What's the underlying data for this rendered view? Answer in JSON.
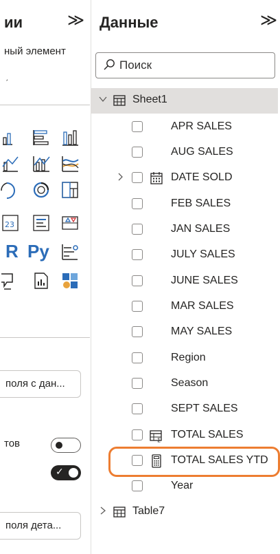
{
  "left_panel": {
    "title_fragment": "ии",
    "collapse_glyph": "≫",
    "subtitle_fragment": "ный элемент",
    "small_mark": "ˏ",
    "text_tiles": [
      "R",
      "Py"
    ],
    "field_wells": [
      "поля с дан...",
      "поля дета..."
    ],
    "toggle_label_fragment": "тов"
  },
  "data_panel": {
    "title": "Данные",
    "collapse_glyph": "≫",
    "search": {
      "placeholder": "Поиск"
    },
    "tables": [
      {
        "name": "Sheet1",
        "expanded": true,
        "fields": [
          {
            "name": "APR SALES",
            "type": "none"
          },
          {
            "name": "AUG SALES",
            "type": "none"
          },
          {
            "name": "DATE SOLD",
            "type": "date-hierarchy"
          },
          {
            "name": "FEB SALES",
            "type": "none"
          },
          {
            "name": "JAN SALES",
            "type": "none"
          },
          {
            "name": "JULY SALES",
            "type": "none"
          },
          {
            "name": "JUNE SALES",
            "type": "none"
          },
          {
            "name": "MAR SALES",
            "type": "none"
          },
          {
            "name": "MAY SALES",
            "type": "none"
          },
          {
            "name": "Region",
            "type": "none"
          },
          {
            "name": "Season",
            "type": "none"
          },
          {
            "name": "SEPT SALES",
            "type": "none"
          },
          {
            "name": "TOTAL SALES",
            "type": "calculated-column"
          },
          {
            "name": "TOTAL SALES YTD",
            "type": "measure",
            "highlighted": true
          },
          {
            "name": "Year",
            "type": "none"
          }
        ]
      },
      {
        "name": "Table7",
        "expanded": false
      }
    ]
  },
  "colors": {
    "highlight": "#ed7d31",
    "selected_row": "#e1dfdd",
    "accent_blue": "#2b6cb8",
    "accent_orange": "#e8a33d"
  }
}
